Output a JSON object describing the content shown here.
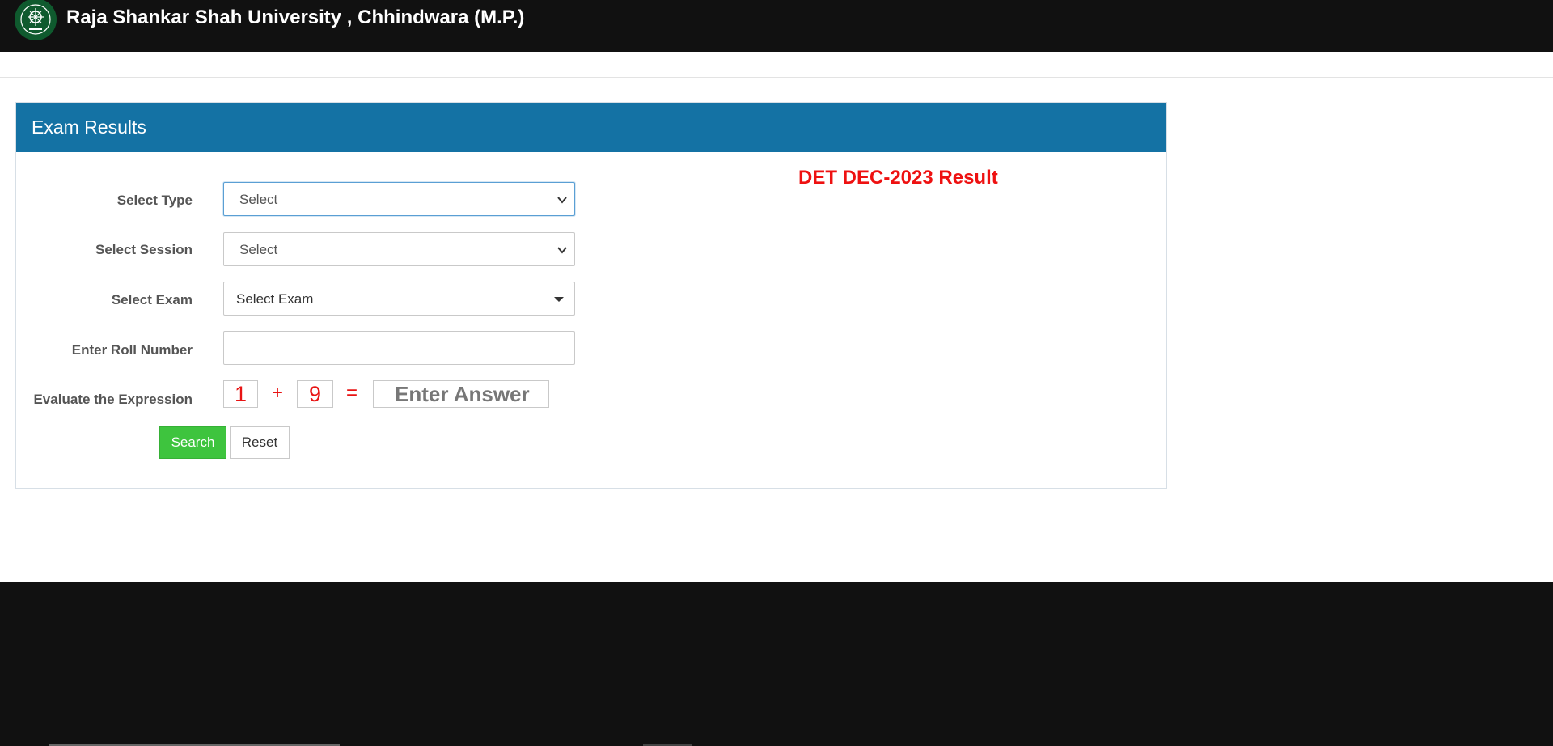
{
  "header": {
    "title": "Raja Shankar Shah University , Chhindwara (M.P.)",
    "logo_icon": "university-seal-icon",
    "background": "#111111"
  },
  "panel": {
    "title": "Exam Results",
    "heading_color": "#1472a4"
  },
  "notice": {
    "text": "DET DEC-2023 Result",
    "color": "#ee1111"
  },
  "form": {
    "type_label": "Select Type",
    "type_value": "Select",
    "session_label": "Select Session",
    "session_value": "Select",
    "exam_label": "Select Exam",
    "exam_value": "Select Exam",
    "roll_label": "Enter Roll Number",
    "roll_value": "",
    "captcha_label": "Evaluate the Expression",
    "captcha_a": "1",
    "captcha_op": "+",
    "captcha_b": "9",
    "captcha_eq": "=",
    "answer_placeholder": "Enter Answer"
  },
  "buttons": {
    "search_label": "Search",
    "search_color": "#3ec43e",
    "reset_label": "Reset"
  }
}
